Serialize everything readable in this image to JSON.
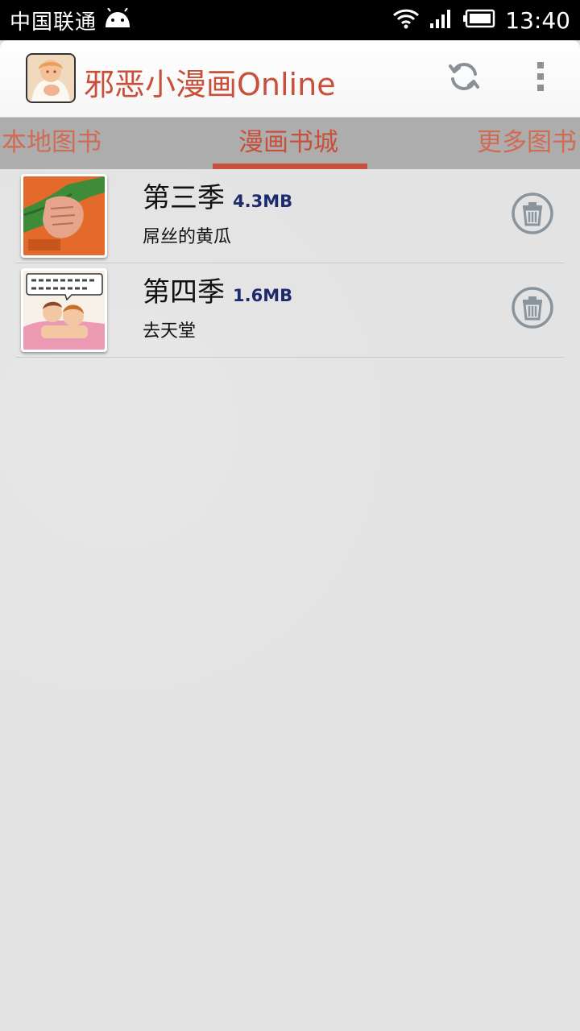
{
  "status_bar": {
    "carrier": "中国联通",
    "time": "13:40",
    "icons": [
      "android-icon",
      "wifi-icon",
      "signal-icon",
      "battery-icon"
    ]
  },
  "action_bar": {
    "title": "邪恶小漫画Online",
    "refresh_icon": "refresh-icon",
    "menu_icon": "overflow-menu-icon"
  },
  "tabs": [
    {
      "label": "本地图书",
      "selected": false
    },
    {
      "label": "漫画书城",
      "selected": true
    },
    {
      "label": "更多图书",
      "selected": false
    }
  ],
  "books": [
    {
      "title": "第三季",
      "size": "4.3MB",
      "subtitle": "屌丝的黄瓜",
      "action_icon": "trash-icon"
    },
    {
      "title": "第四季",
      "size": "1.6MB",
      "subtitle": "去天堂",
      "action_icon": "trash-icon"
    }
  ],
  "colors": {
    "accent": "#c8503a",
    "tab_bar": "#adadad",
    "size_text": "#1e2a6e",
    "icon_gray": "#8a949c"
  }
}
